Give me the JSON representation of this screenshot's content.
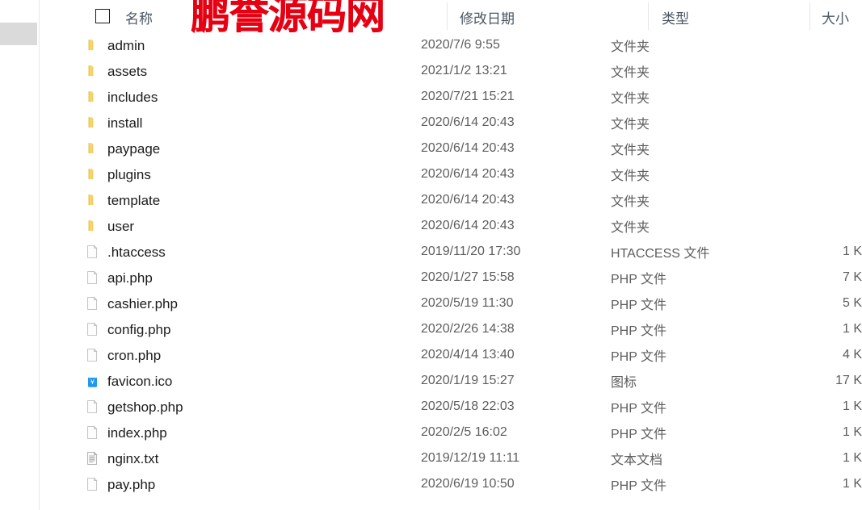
{
  "watermark": {
    "text": "鹏誉源码网",
    "color": "#e60012"
  },
  "header": {
    "columns": [
      {
        "key": "name",
        "label": "名称"
      },
      {
        "key": "date",
        "label": "修改日期"
      },
      {
        "key": "type",
        "label": "类型"
      },
      {
        "key": "size",
        "label": "大小"
      }
    ],
    "name_label": "名称",
    "date_label": "修改日期",
    "type_label": "类型",
    "size_label": "大小"
  },
  "files": [
    {
      "name": "admin",
      "date": "2020/7/6 9:55",
      "type": "文件夹",
      "size": "",
      "icon": "folder-icon"
    },
    {
      "name": "assets",
      "date": "2021/1/2 13:21",
      "type": "文件夹",
      "size": "",
      "icon": "folder-icon"
    },
    {
      "name": "includes",
      "date": "2020/7/21 15:21",
      "type": "文件夹",
      "size": "",
      "icon": "folder-icon"
    },
    {
      "name": "install",
      "date": "2020/6/14 20:43",
      "type": "文件夹",
      "size": "",
      "icon": "folder-icon"
    },
    {
      "name": "paypage",
      "date": "2020/6/14 20:43",
      "type": "文件夹",
      "size": "",
      "icon": "folder-icon"
    },
    {
      "name": "plugins",
      "date": "2020/6/14 20:43",
      "type": "文件夹",
      "size": "",
      "icon": "folder-icon"
    },
    {
      "name": "template",
      "date": "2020/6/14 20:43",
      "type": "文件夹",
      "size": "",
      "icon": "folder-icon"
    },
    {
      "name": "user",
      "date": "2020/6/14 20:43",
      "type": "文件夹",
      "size": "",
      "icon": "folder-icon"
    },
    {
      "name": ".htaccess",
      "date": "2019/11/20 17:30",
      "type": "HTACCESS 文件",
      "size": "1 K",
      "icon": "file-icon"
    },
    {
      "name": "api.php",
      "date": "2020/1/27 15:58",
      "type": "PHP 文件",
      "size": "7 K",
      "icon": "file-icon"
    },
    {
      "name": "cashier.php",
      "date": "2020/5/19 11:30",
      "type": "PHP 文件",
      "size": "5 K",
      "icon": "file-icon"
    },
    {
      "name": "config.php",
      "date": "2020/2/26 14:38",
      "type": "PHP 文件",
      "size": "1 K",
      "icon": "file-icon"
    },
    {
      "name": "cron.php",
      "date": "2020/4/14 13:40",
      "type": "PHP 文件",
      "size": "4 K",
      "icon": "file-icon"
    },
    {
      "name": "favicon.ico",
      "date": "2020/1/19 15:27",
      "type": "图标",
      "size": "17 K",
      "icon": "shopping-bag-icon"
    },
    {
      "name": "getshop.php",
      "date": "2020/5/18 22:03",
      "type": "PHP 文件",
      "size": "1 K",
      "icon": "file-icon"
    },
    {
      "name": "index.php",
      "date": "2020/2/5 16:02",
      "type": "PHP 文件",
      "size": "1 K",
      "icon": "file-icon"
    },
    {
      "name": "nginx.txt",
      "date": "2019/12/19 11:11",
      "type": "文本文档",
      "size": "1 K",
      "icon": "text-file-icon"
    },
    {
      "name": "pay.php",
      "date": "2020/6/19 10:50",
      "type": "PHP 文件",
      "size": "1 K",
      "icon": "file-icon"
    }
  ]
}
